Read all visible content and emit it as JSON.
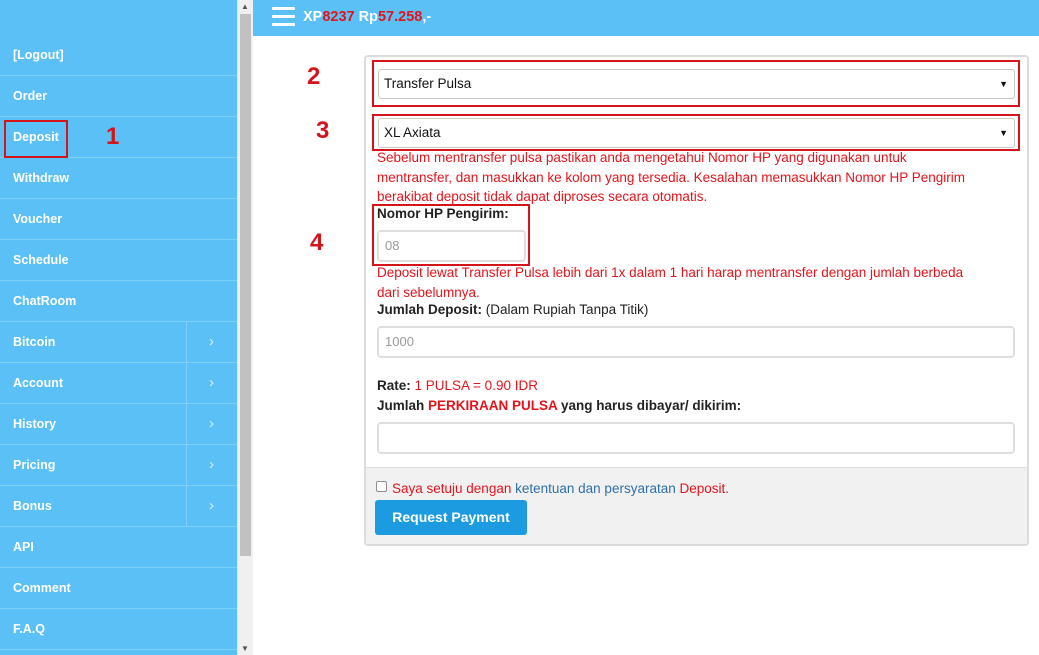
{
  "header": {
    "xp_prefix": "XP",
    "xp_value": "8237",
    "rp_prefix": "Rp",
    "rp_value": "57.258",
    "rp_suffix": ",-"
  },
  "sidebar": {
    "items": [
      {
        "label": "[Logout]",
        "has_submenu": false
      },
      {
        "label": "Order",
        "has_submenu": false
      },
      {
        "label": "Deposit",
        "has_submenu": false
      },
      {
        "label": "Withdraw",
        "has_submenu": false
      },
      {
        "label": "Voucher",
        "has_submenu": false
      },
      {
        "label": "Schedule",
        "has_submenu": false
      },
      {
        "label": "ChatRoom",
        "has_submenu": false
      },
      {
        "label": "Bitcoin",
        "has_submenu": true
      },
      {
        "label": "Account",
        "has_submenu": true
      },
      {
        "label": "History",
        "has_submenu": true
      },
      {
        "label": "Pricing",
        "has_submenu": true
      },
      {
        "label": "Bonus",
        "has_submenu": true
      },
      {
        "label": "API",
        "has_submenu": false
      },
      {
        "label": "Comment",
        "has_submenu": false
      },
      {
        "label": "F.A.Q",
        "has_submenu": false
      }
    ]
  },
  "annotations": {
    "n1": "1",
    "n2": "2",
    "n3": "3",
    "n4": "4"
  },
  "form": {
    "method_select": "Transfer Pulsa",
    "provider_select": "XL Axiata",
    "warning_1_line1": "Sebelum mentransfer pulsa pastikan anda mengetahui Nomor HP yang digunakan untuk",
    "warning_1_line2": "mentransfer, dan masukkan ke kolom yang tersedia. Kesalahan memasukkan Nomor HP Pengirim",
    "warning_1_line3": "berakibat deposit tidak dapat diproses secara otomatis.",
    "sender_label": "Nomor HP Pengirim:",
    "sender_placeholder": "08",
    "warning_2_line1": "Deposit lewat Transfer Pulsa lebih dari 1x dalam 1 hari harap mentransfer dengan jumlah berbeda",
    "warning_2_line2": "dari sebelumnya.",
    "amount_label": "Jumlah Deposit:",
    "amount_hint": " (Dalam Rupiah Tanpa Titik)",
    "amount_placeholder": "1000",
    "rate_label": "Rate:",
    "rate_value": " 1 PULSA = 0.90 IDR",
    "estimate_label_a": "Jumlah ",
    "estimate_label_b": "PERKIRAAN PULSA",
    "estimate_label_c": " yang harus dibayar/ dikirim:",
    "estimate_value": "",
    "agree_a": "Saya setuju dengan ",
    "agree_link": "ketentuan dan persyaratan",
    "agree_c": " Deposit.",
    "submit": "Request Payment"
  }
}
